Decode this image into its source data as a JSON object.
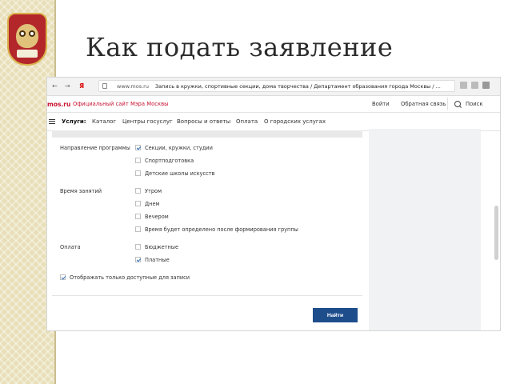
{
  "slide": {
    "title": "Как подать заявление",
    "logo_icon": "owl-school-emblem-icon"
  },
  "browser": {
    "nav_back": "←",
    "nav_forward": "→",
    "yandex_label": "Я",
    "address_domain": "www.mos.ru",
    "page_title": "Запись в кружки, спортивные секции, дома творчества / Департамент образования города Москвы / ..."
  },
  "site_header": {
    "logo_text": "mos.ru",
    "official_text": "Официальный сайт Мэра Москвы",
    "login": "Войти",
    "feedback": "Обратная связь",
    "search": "Поиск",
    "brand_color": "#c8102e"
  },
  "main_nav": {
    "items": [
      "Услуги:",
      "Каталог",
      "Центры госуслуг",
      "Вопросы и ответы",
      "Оплата",
      "О городских услугах"
    ]
  },
  "filters": {
    "direction": {
      "label": "Направление программы",
      "options": [
        {
          "label": "Секции, кружки, студии",
          "checked": true
        },
        {
          "label": "Спортподготовка",
          "checked": false
        },
        {
          "label": "Детские школы искусств",
          "checked": false
        }
      ]
    },
    "time": {
      "label": "Время занятий",
      "options": [
        {
          "label": "Утром",
          "checked": false
        },
        {
          "label": "Днем",
          "checked": false
        },
        {
          "label": "Вечером",
          "checked": false
        },
        {
          "label": "Время будет определено после формирования группы",
          "checked": false
        }
      ]
    },
    "payment": {
      "label": "Оплата",
      "options": [
        {
          "label": "Бюджетные",
          "checked": false
        },
        {
          "label": "Платные",
          "checked": true
        }
      ]
    },
    "available_only": {
      "label": "Отображать только доступные для записи",
      "checked": true
    }
  },
  "actions": {
    "find": "Найти",
    "find_color": "#1e4d8c"
  }
}
